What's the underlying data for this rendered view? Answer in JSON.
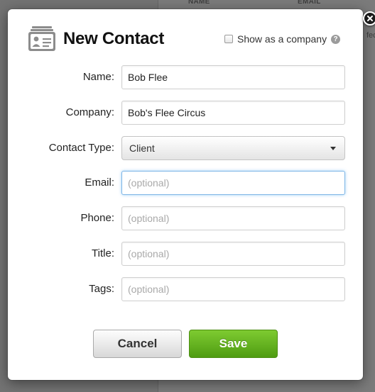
{
  "background": {
    "columns": [
      "NAME",
      "EMAIL"
    ],
    "fragment": "fecy"
  },
  "dialog": {
    "title": "New Contact",
    "show_as_company_label": "Show as a company",
    "help_glyph": "?",
    "fields": {
      "name": {
        "label": "Name:",
        "value": "Bob Flee",
        "placeholder": ""
      },
      "company": {
        "label": "Company:",
        "value": "Bob's Flee Circus",
        "placeholder": ""
      },
      "contact_type": {
        "label": "Contact Type:",
        "selected": "Client"
      },
      "email": {
        "label": "Email:",
        "value": "",
        "placeholder": "(optional)"
      },
      "phone": {
        "label": "Phone:",
        "value": "",
        "placeholder": "(optional)"
      },
      "title": {
        "label": "Title:",
        "value": "",
        "placeholder": "(optional)"
      },
      "tags": {
        "label": "Tags:",
        "value": "",
        "placeholder": "(optional)"
      }
    },
    "buttons": {
      "cancel": "Cancel",
      "save": "Save"
    }
  },
  "icons": {
    "close": "close-icon",
    "contact_card": "contact-card-icon",
    "help": "help-icon",
    "caret": "chevron-down-icon"
  },
  "colors": {
    "save_button": "#5fae1e",
    "focus_ring": "#7fb6e6",
    "overlay": "#6e6e6e"
  }
}
